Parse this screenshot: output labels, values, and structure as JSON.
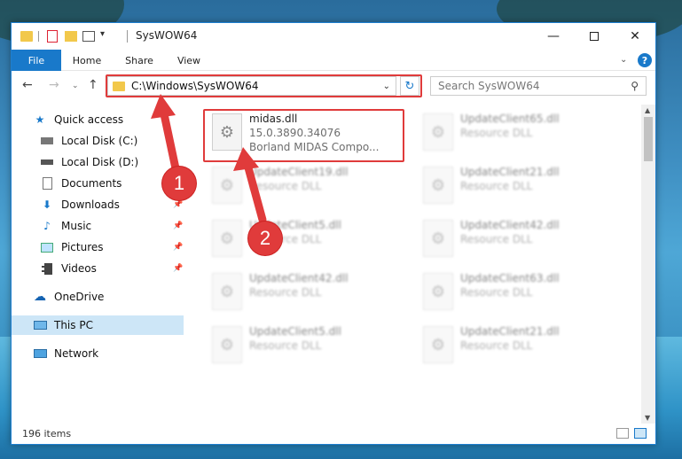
{
  "window": {
    "title": "SysWOW64"
  },
  "ribbon": {
    "tabs": [
      "File",
      "Home",
      "Share",
      "View"
    ]
  },
  "navigation": {
    "address": "C:\\Windows\\SysWOW64",
    "search_placeholder": "Search SysWOW64"
  },
  "sidebar": {
    "items": [
      {
        "label": "Quick access",
        "icon": "star-icon",
        "pinned": false
      },
      {
        "label": "Local Disk (C:)",
        "icon": "drive-icon",
        "pinned": false
      },
      {
        "label": "Local Disk (D:)",
        "icon": "drive-icon",
        "pinned": false
      },
      {
        "label": "Documents",
        "icon": "documents-icon",
        "pinned": false
      },
      {
        "label": "Downloads",
        "icon": "download-icon",
        "pinned": true
      },
      {
        "label": "Music",
        "icon": "music-icon",
        "pinned": true
      },
      {
        "label": "Pictures",
        "icon": "pictures-icon",
        "pinned": true
      },
      {
        "label": "Videos",
        "icon": "videos-icon",
        "pinned": true
      },
      {
        "label": "OneDrive",
        "icon": "cloud-icon",
        "pinned": false
      },
      {
        "label": "This PC",
        "icon": "computer-icon",
        "pinned": false,
        "selected": true
      },
      {
        "label": "Network",
        "icon": "network-icon",
        "pinned": false
      }
    ]
  },
  "files": {
    "highlighted": {
      "name": "midas.dll",
      "version": "15.0.3890.34076",
      "description": "Borland MIDAS Compo..."
    },
    "col1": [
      {
        "name": "UpdateClient19.dll",
        "type": "Resource DLL"
      },
      {
        "name": "UpdateClient5.dll",
        "type": "Resource DLL"
      },
      {
        "name": "UpdateClient42.dll",
        "type": "Resource DLL"
      },
      {
        "name": "UpdateClient5.dll",
        "type": "Resource DLL"
      }
    ],
    "col2": [
      {
        "name": "UpdateClient65.dll",
        "type": "Resource DLL"
      },
      {
        "name": "UpdateClient21.dll",
        "type": "Resource DLL"
      },
      {
        "name": "UpdateClient42.dll",
        "type": "Resource DLL"
      },
      {
        "name": "UpdateClient63.dll",
        "type": "Resource DLL"
      },
      {
        "name": "UpdateClient21.dll",
        "type": "Resource DLL"
      }
    ]
  },
  "status": {
    "count": "196 items"
  },
  "annotations": {
    "step1": "1",
    "step2": "2"
  },
  "colors": {
    "accent": "#1979ca",
    "highlight": "#e03b3b"
  }
}
